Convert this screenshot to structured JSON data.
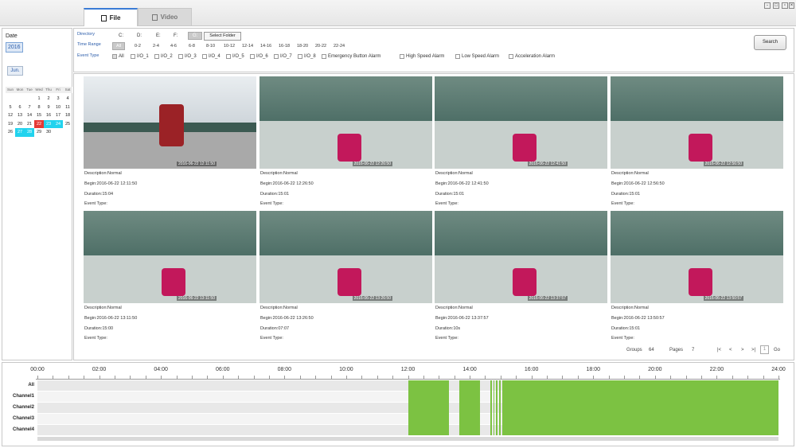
{
  "tabs": [
    {
      "label": "File"
    },
    {
      "label": "Video"
    }
  ],
  "date_panel": {
    "label": "Date",
    "year": "2016",
    "month": "Jun.",
    "weekdays": [
      "Sun",
      "Mon",
      "Tue",
      "Wed",
      "Thu",
      "Fri",
      "Sat"
    ],
    "days": [
      "",
      "",
      "",
      "1",
      "2",
      "3",
      "4",
      "5",
      "6",
      "7",
      "8",
      "9",
      "10",
      "11",
      "12",
      "13",
      "14",
      "15",
      "16",
      "17",
      "18",
      "19",
      "20",
      "21",
      "22",
      "23",
      "24",
      "25",
      "26",
      "27",
      "28",
      "29",
      "30"
    ],
    "highlight_red": [
      "22"
    ],
    "highlight_cyan": [
      "23",
      "24",
      "27",
      "28"
    ]
  },
  "filters": {
    "directory_label": "Directory",
    "drives": [
      "C:",
      "D:",
      "E:",
      "F:",
      "G:"
    ],
    "selected_drive": "G:",
    "select_folder": "Select Folder",
    "time_range_label": "Time Range",
    "time_ranges": [
      "All",
      "0-2",
      "2-4",
      "4-6",
      "6-8",
      "8-10",
      "10-12",
      "12-14",
      "14-16",
      "16-18",
      "18-20",
      "20-22",
      "22-24"
    ],
    "event_type_label": "Event Type",
    "event_types": [
      "All",
      "I/O_1",
      "I/O_2",
      "I/O_3",
      "I/O_4",
      "I/O_5",
      "I/O_6",
      "I/O_7",
      "I/O_8",
      "Emergency Button Alarm",
      "High Speed Alarm",
      "Low Speed Alarm",
      "Acceleration Alarm"
    ],
    "search": "Search"
  },
  "records": [
    {
      "desc": "Description:Normal",
      "begin": "Begin:2016-06-22 12:11:50",
      "duration": "Duration:15:04",
      "event": "Event Type:",
      "ts": "2016-06-22 12:11:50"
    },
    {
      "desc": "Description:Normal",
      "begin": "Begin:2016-06-22 12:26:50",
      "duration": "Duration:15:01",
      "event": "Event Type:",
      "ts": "2016-06-22 12:26:50"
    },
    {
      "desc": "Description:Normal",
      "begin": "Begin:2016-06-22 12:41:50",
      "duration": "Duration:15:01",
      "event": "Event Type:",
      "ts": "2016-06-22 12:41:50"
    },
    {
      "desc": "Description:Normal",
      "begin": "Begin:2016-06-22 12:56:50",
      "duration": "Duration:15:01",
      "event": "Event Type:",
      "ts": "2016-06-22 12:56:50"
    },
    {
      "desc": "Description:Normal",
      "begin": "Begin:2016-06-22 13:11:50",
      "duration": "Duration:15:00",
      "event": "Event Type:",
      "ts": "2016-06-22 13:11:50"
    },
    {
      "desc": "Description:Normal",
      "begin": "Begin:2016-06-22 13:26:50",
      "duration": "Duration:07:07",
      "event": "Event Type:",
      "ts": "2016-06-22 13:26:50"
    },
    {
      "desc": "Description:Normal",
      "begin": "Begin:2016-06-22 13:37:57",
      "duration": "Duration:10s",
      "event": "Event Type:",
      "ts": "2016-06-22 13:37:57"
    },
    {
      "desc": "Description:Normal",
      "begin": "Begin:2016-06-22 13:50:57",
      "duration": "Duration:15:01",
      "event": "Event Type:",
      "ts": "2016-06-22 13:50:57"
    }
  ],
  "pager": {
    "groups_label": "Groups",
    "groups": "64",
    "pages_label": "Pages",
    "pages": "7",
    "first": "|<",
    "prev": "<",
    "next": ">",
    "last": ">|",
    "page": "1",
    "go": "Go"
  },
  "timeline": {
    "hours": [
      "00:00",
      "02:00",
      "04:00",
      "06:00",
      "08:00",
      "10:00",
      "12:00",
      "14:00",
      "16:00",
      "18:00",
      "20:00",
      "22:00",
      "24:00"
    ],
    "channels": [
      "All",
      "Channel1",
      "Channel2",
      "Channel3",
      "Channel4"
    ],
    "recorded_hours": [
      [
        12.0,
        13.33
      ],
      [
        13.66,
        14.33
      ],
      [
        14.66,
        14.72
      ],
      [
        14.78,
        14.8
      ],
      [
        14.85,
        14.9
      ],
      [
        14.95,
        15.0
      ],
      [
        15.05,
        24.0
      ]
    ]
  },
  "colors": {
    "recorded": "#7cc242",
    "accent": "#3a7bd5",
    "day_red": "#e53935",
    "day_cyan": "#22d3ee"
  }
}
